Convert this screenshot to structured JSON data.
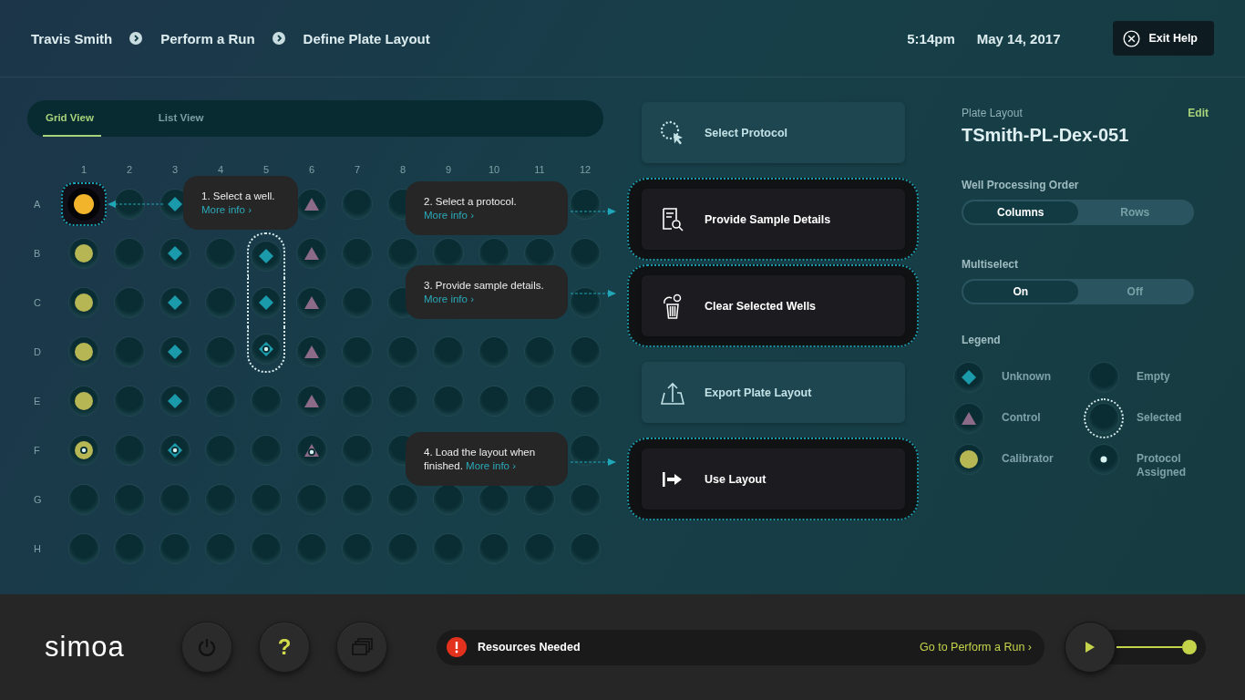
{
  "header": {
    "breadcrumbs": [
      "Travis Smith",
      "Perform a Run",
      "Define Plate Layout"
    ],
    "time": "5:14pm",
    "date": "May 14, 2017",
    "exit_button": "Exit Help"
  },
  "view_tabs": [
    {
      "label": "Grid View",
      "selected": true
    },
    {
      "label": "List View",
      "selected": false
    }
  ],
  "plate": {
    "columns": [
      "1",
      "2",
      "3",
      "4",
      "5",
      "6",
      "7",
      "8",
      "9",
      "10",
      "11",
      "12"
    ],
    "rows": [
      {
        "label": "A",
        "wells": [
          {
            "kind": "active",
            "assigned": false,
            "selected": true
          },
          {
            "kind": "empty",
            "assigned": false,
            "selected": false
          },
          {
            "kind": "unknown",
            "assigned": false,
            "selected": false
          },
          {
            "kind": "covered"
          },
          {
            "kind": "covered"
          },
          {
            "kind": "control",
            "assigned": false,
            "selected": false
          },
          {
            "kind": "empty",
            "assigned": false,
            "selected": false
          },
          {
            "kind": "empty",
            "assigned": false,
            "selected": false
          },
          {
            "kind": "covered"
          },
          {
            "kind": "covered"
          },
          {
            "kind": "covered"
          },
          {
            "kind": "empty",
            "assigned": false,
            "selected": false
          }
        ]
      },
      {
        "label": "B",
        "wells": [
          {
            "kind": "calibrator",
            "assigned": false,
            "selected": false
          },
          {
            "kind": "empty",
            "assigned": false,
            "selected": false
          },
          {
            "kind": "unknown",
            "assigned": false,
            "selected": false
          },
          {
            "kind": "empty",
            "assigned": false,
            "selected": false
          },
          {
            "kind": "unknown",
            "assigned": false,
            "selected": true
          },
          {
            "kind": "control",
            "assigned": false,
            "selected": false
          },
          {
            "kind": "empty",
            "assigned": false,
            "selected": false
          },
          {
            "kind": "empty",
            "assigned": false,
            "selected": false
          },
          {
            "kind": "empty",
            "assigned": false,
            "selected": false
          },
          {
            "kind": "empty",
            "assigned": false,
            "selected": false
          },
          {
            "kind": "empty",
            "assigned": false,
            "selected": false
          },
          {
            "kind": "empty",
            "assigned": false,
            "selected": false
          }
        ]
      },
      {
        "label": "C",
        "wells": [
          {
            "kind": "calibrator",
            "assigned": false,
            "selected": false
          },
          {
            "kind": "empty",
            "assigned": false,
            "selected": false
          },
          {
            "kind": "unknown",
            "assigned": false,
            "selected": false
          },
          {
            "kind": "empty",
            "assigned": false,
            "selected": false
          },
          {
            "kind": "unknown",
            "assigned": false,
            "selected": true
          },
          {
            "kind": "control",
            "assigned": false,
            "selected": false
          },
          {
            "kind": "empty",
            "assigned": false,
            "selected": false
          },
          {
            "kind": "empty",
            "assigned": false,
            "selected": false
          },
          {
            "kind": "covered"
          },
          {
            "kind": "covered"
          },
          {
            "kind": "covered"
          },
          {
            "kind": "empty",
            "assigned": false,
            "selected": false
          }
        ]
      },
      {
        "label": "D",
        "wells": [
          {
            "kind": "calibrator",
            "assigned": false,
            "selected": false
          },
          {
            "kind": "empty",
            "assigned": false,
            "selected": false
          },
          {
            "kind": "unknown",
            "assigned": false,
            "selected": false
          },
          {
            "kind": "empty",
            "assigned": false,
            "selected": false
          },
          {
            "kind": "unknown",
            "assigned": true,
            "selected": true
          },
          {
            "kind": "control",
            "assigned": false,
            "selected": false
          },
          {
            "kind": "empty",
            "assigned": false,
            "selected": false
          },
          {
            "kind": "empty",
            "assigned": false,
            "selected": false
          },
          {
            "kind": "empty",
            "assigned": false,
            "selected": false
          },
          {
            "kind": "empty",
            "assigned": false,
            "selected": false
          },
          {
            "kind": "empty",
            "assigned": false,
            "selected": false
          },
          {
            "kind": "empty",
            "assigned": false,
            "selected": false
          }
        ]
      },
      {
        "label": "E",
        "wells": [
          {
            "kind": "calibrator",
            "assigned": false,
            "selected": false
          },
          {
            "kind": "empty",
            "assigned": false,
            "selected": false
          },
          {
            "kind": "unknown",
            "assigned": false,
            "selected": false
          },
          {
            "kind": "empty",
            "assigned": false,
            "selected": false
          },
          {
            "kind": "empty",
            "assigned": false,
            "selected": false
          },
          {
            "kind": "control",
            "assigned": false,
            "selected": false
          },
          {
            "kind": "empty",
            "assigned": false,
            "selected": false
          },
          {
            "kind": "empty",
            "assigned": false,
            "selected": false
          },
          {
            "kind": "empty",
            "assigned": false,
            "selected": false
          },
          {
            "kind": "empty",
            "assigned": false,
            "selected": false
          },
          {
            "kind": "empty",
            "assigned": false,
            "selected": false
          },
          {
            "kind": "empty",
            "assigned": false,
            "selected": false
          }
        ]
      },
      {
        "label": "F",
        "wells": [
          {
            "kind": "calibrator",
            "assigned": true,
            "selected": false
          },
          {
            "kind": "empty",
            "assigned": false,
            "selected": false
          },
          {
            "kind": "unknown",
            "assigned": true,
            "selected": false
          },
          {
            "kind": "empty",
            "assigned": false,
            "selected": false
          },
          {
            "kind": "empty",
            "assigned": false,
            "selected": false
          },
          {
            "kind": "control",
            "assigned": true,
            "selected": false
          },
          {
            "kind": "empty",
            "assigned": false,
            "selected": false
          },
          {
            "kind": "empty",
            "assigned": false,
            "selected": false
          },
          {
            "kind": "covered"
          },
          {
            "kind": "covered"
          },
          {
            "kind": "covered"
          },
          {
            "kind": "empty",
            "assigned": false,
            "selected": false
          }
        ]
      },
      {
        "label": "G",
        "wells": [
          {
            "kind": "empty",
            "assigned": false,
            "selected": false
          },
          {
            "kind": "empty",
            "assigned": false,
            "selected": false
          },
          {
            "kind": "empty",
            "assigned": false,
            "selected": false
          },
          {
            "kind": "empty",
            "assigned": false,
            "selected": false
          },
          {
            "kind": "empty",
            "assigned": false,
            "selected": false
          },
          {
            "kind": "empty",
            "assigned": false,
            "selected": false
          },
          {
            "kind": "empty",
            "assigned": false,
            "selected": false
          },
          {
            "kind": "empty",
            "assigned": false,
            "selected": false
          },
          {
            "kind": "empty",
            "assigned": false,
            "selected": false
          },
          {
            "kind": "empty",
            "assigned": false,
            "selected": false
          },
          {
            "kind": "empty",
            "assigned": false,
            "selected": false
          },
          {
            "kind": "empty",
            "assigned": false,
            "selected": false
          }
        ]
      },
      {
        "label": "H",
        "wells": [
          {
            "kind": "empty",
            "assigned": false,
            "selected": false
          },
          {
            "kind": "empty",
            "assigned": false,
            "selected": false
          },
          {
            "kind": "empty",
            "assigned": false,
            "selected": false
          },
          {
            "kind": "empty",
            "assigned": false,
            "selected": false
          },
          {
            "kind": "empty",
            "assigned": false,
            "selected": false
          },
          {
            "kind": "empty",
            "assigned": false,
            "selected": false
          },
          {
            "kind": "empty",
            "assigned": false,
            "selected": false
          },
          {
            "kind": "empty",
            "assigned": false,
            "selected": false
          },
          {
            "kind": "empty",
            "assigned": false,
            "selected": false
          },
          {
            "kind": "empty",
            "assigned": false,
            "selected": false
          },
          {
            "kind": "empty",
            "assigned": false,
            "selected": false
          },
          {
            "kind": "empty",
            "assigned": false,
            "selected": false
          }
        ]
      }
    ]
  },
  "tips": [
    {
      "text": "1. Select a well.",
      "link": "More info ›"
    },
    {
      "text": "2. Select a protocol.",
      "link": "More info ›"
    },
    {
      "text": "3. Provide sample details.",
      "link": "More info ›"
    },
    {
      "text": "4. Load the layout when finished.",
      "link": "More info ›"
    }
  ],
  "actions": [
    {
      "label": "Select Protocol",
      "highlighted": false
    },
    {
      "label": "Provide Sample Details",
      "highlighted": true
    },
    {
      "label": "Clear Selected Wells",
      "highlighted": true
    },
    {
      "label": "Export Plate Layout",
      "highlighted": false
    },
    {
      "label": "Use Layout",
      "highlighted": true
    }
  ],
  "plate_layout": {
    "label": "Plate Layout",
    "edit": "Edit",
    "name": "TSmith-PL-Dex-051"
  },
  "settings": [
    {
      "label": "Well Processing Order",
      "options": [
        {
          "label": "Columns",
          "selected": true
        },
        {
          "label": "Rows",
          "selected": false
        }
      ]
    },
    {
      "label": "Multiselect",
      "options": [
        {
          "label": "On",
          "selected": true
        },
        {
          "label": "Off",
          "selected": false
        }
      ]
    }
  ],
  "legend": {
    "title": "Legend",
    "items": [
      {
        "kind": "unknown",
        "label": "Unknown"
      },
      {
        "kind": "empty",
        "label": "Empty"
      },
      {
        "kind": "control",
        "label": "Control"
      },
      {
        "kind": "selected",
        "label": "Selected"
      },
      {
        "kind": "calibrator",
        "label": "Calibrator"
      },
      {
        "kind": "assigned",
        "label": "Protocol Assigned"
      }
    ]
  },
  "footer": {
    "logo": "simoa",
    "help_key": "?",
    "status": {
      "message": "Resources Needed",
      "link": "Go to Perform a Run ›"
    },
    "run_slider": {
      "level": 1
    }
  }
}
